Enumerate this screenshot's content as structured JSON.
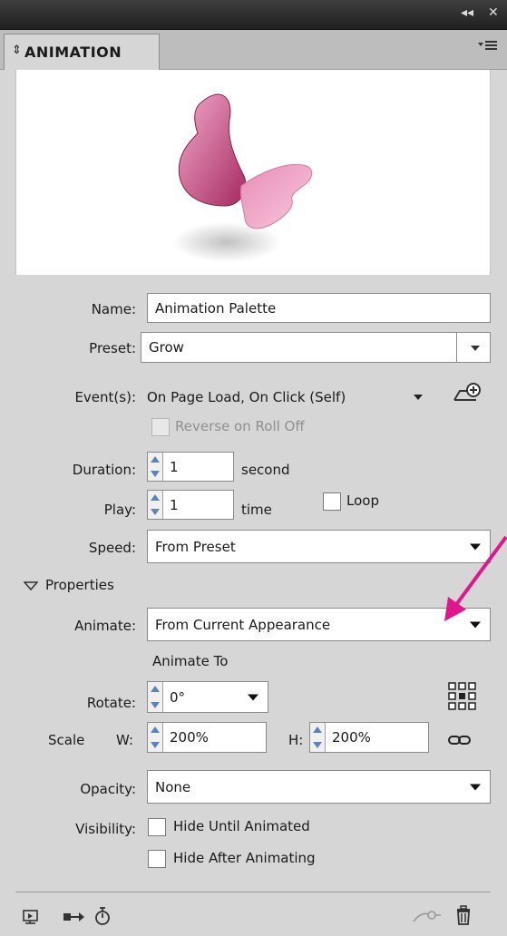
{
  "panel": {
    "title": "ANIMATION",
    "title_arrows": "⇕"
  },
  "topbar": {
    "collapse": "◂◂",
    "close": "✕"
  },
  "form": {
    "name_label": "Name:",
    "name_value": "Animation Palette",
    "preset_label": "Preset:",
    "preset_value": "Grow",
    "events_label": "Event(s):",
    "events_value": "On Page Load, On Click (Self)",
    "reverse_label": "Reverse on Roll Off",
    "duration_label": "Duration:",
    "duration_value": "1",
    "duration_unit": "second",
    "play_label": "Play:",
    "play_value": "1",
    "play_unit": "time",
    "loop_label": "Loop",
    "speed_label": "Speed:",
    "speed_value": "From Preset"
  },
  "properties": {
    "header": "Properties",
    "animate_label": "Animate:",
    "animate_value": "From Current Appearance",
    "animate_to_label": "Animate To",
    "rotate_label": "Rotate:",
    "rotate_value": "0°",
    "scale_label": "Scale",
    "w_label": "W:",
    "w_value": "200%",
    "h_label": "H:",
    "h_value": "200%",
    "opacity_label": "Opacity:",
    "opacity_value": "None",
    "visibility_label": "Visibility:",
    "hide_until_label": "Hide Until Animated",
    "hide_after_label": "Hide After Animating"
  },
  "colors": {
    "accent_arrow": "#e0168c",
    "butterfly_dark": "#b0306a",
    "butterfly_light": "#f0a6c8"
  }
}
